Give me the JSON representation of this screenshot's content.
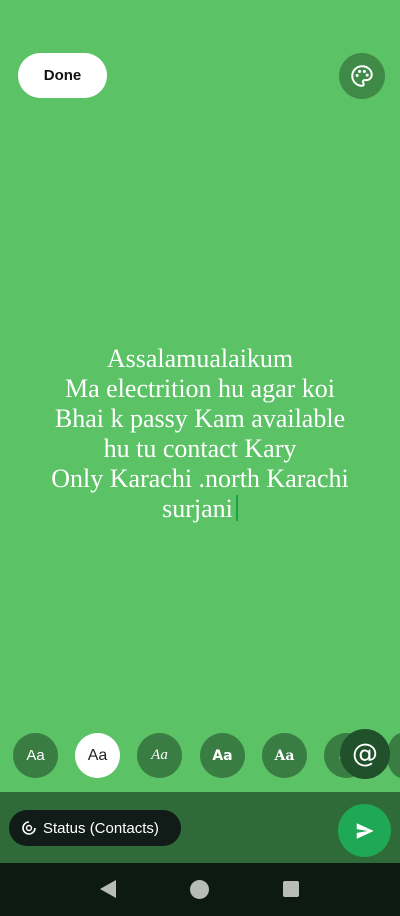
{
  "top": {
    "done_label": "Done",
    "palette_icon": "palette-icon"
  },
  "status": {
    "lines": [
      "Assalamualaikum",
      "Ma electrition hu agar koi",
      "Bhai k passy Kam available",
      "hu tu contact Kary",
      "Only Karachi .north Karachi",
      "surjani"
    ],
    "background_color": "#5bc266",
    "text_color": "#ffffff"
  },
  "font_picker": {
    "options": [
      "Aa",
      "Aa",
      "Aa",
      "Aa",
      "Aa",
      "Aa"
    ],
    "selected_index": 1,
    "mention_icon": "at-sign-icon",
    "mention_symbol": "@"
  },
  "composer": {
    "audience_label": "Status (Contacts)",
    "audience_icon": "status-ring-icon",
    "send_icon": "send-icon",
    "accent_color": "#1fa855"
  },
  "navigation": {
    "back_icon": "back-icon",
    "home_icon": "home-icon",
    "recents_icon": "recents-icon"
  }
}
